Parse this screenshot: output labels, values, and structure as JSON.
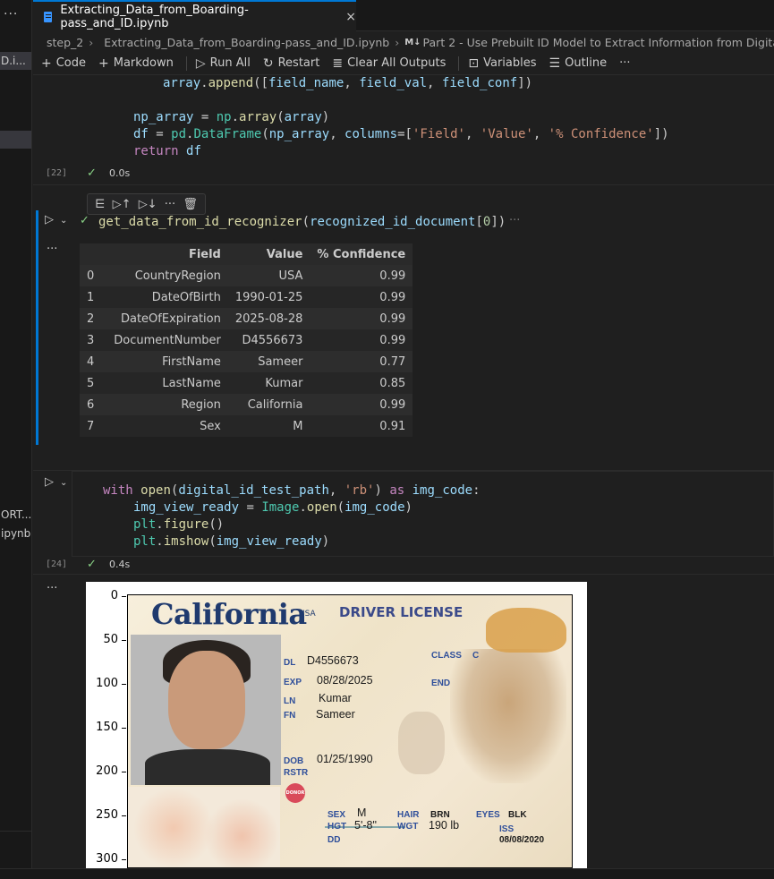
{
  "left_strip": {
    "dots": "···",
    "file1": "D.i...",
    "file2": "ORT...",
    "file3": "ipynb"
  },
  "tab": {
    "label": "Extracting_Data_from_Boarding-pass_and_ID.ipynb",
    "close": "×"
  },
  "breadcrumb": {
    "folder": "step_2",
    "file": "Extracting_Data_from_Boarding-pass_and_ID.ipynb",
    "md_badge": "M↓",
    "section": "Part 2 - Use Prebuilt ID Model to Extract Information from Digital ID"
  },
  "toolbar": {
    "code": "Code",
    "markdown": "Markdown",
    "run_all": "Run All",
    "restart": "Restart",
    "clear": "Clear All Outputs",
    "variables": "Variables",
    "outline": "Outline",
    "more": "···"
  },
  "cell22": {
    "exec_count": "[22]",
    "time": "0.0s",
    "check": "✓"
  },
  "cell23": {
    "code": "get_data_from_id_recognizer(recognized_id_document[0])",
    "trail": "···",
    "output_marker": "···"
  },
  "dataframe": {
    "columns": [
      "",
      "Field",
      "Value",
      "% Confidence"
    ],
    "rows": [
      [
        "0",
        "CountryRegion",
        "USA",
        "0.99"
      ],
      [
        "1",
        "DateOfBirth",
        "1990-01-25",
        "0.99"
      ],
      [
        "2",
        "DateOfExpiration",
        "2025-08-28",
        "0.99"
      ],
      [
        "3",
        "DocumentNumber",
        "D4556673",
        "0.99"
      ],
      [
        "4",
        "FirstName",
        "Sameer",
        "0.77"
      ],
      [
        "5",
        "LastName",
        "Kumar",
        "0.85"
      ],
      [
        "6",
        "Region",
        "California",
        "0.99"
      ],
      [
        "7",
        "Sex",
        "M",
        "0.91"
      ]
    ]
  },
  "cell24": {
    "exec_count": "[24]",
    "time": "0.4s",
    "check": "✓",
    "output_marker": "···"
  },
  "plot": {
    "yticks": [
      "0",
      "50",
      "100",
      "150",
      "200",
      "250",
      "300"
    ]
  },
  "id_card": {
    "state": "California",
    "usa": "USA",
    "title": "DRIVER LICENSE",
    "dl_label": "DL",
    "dl": "D4556673",
    "class_label": "CLASS",
    "class": "C",
    "exp_label": "EXP",
    "exp": "08/28/2025",
    "end_label": "END",
    "ln_label": "LN",
    "ln": "Kumar",
    "fn_label": "FN",
    "fn": "Sameer",
    "dob_label": "DOB",
    "dob": "01/25/1990",
    "rstr_label": "RSTR",
    "donor": "DONOR",
    "sex_label": "SEX",
    "sex": "M",
    "hgt_label": "HGT",
    "hgt": "5'-8\"",
    "hair_label": "HAIR",
    "hair": "BRN",
    "wgt_label": "WGT",
    "wgt": "190 lb",
    "eyes_label": "EYES",
    "eyes": "BLK",
    "iss_label": "ISS",
    "iss": "08/08/2020",
    "dd_label": "DD"
  }
}
